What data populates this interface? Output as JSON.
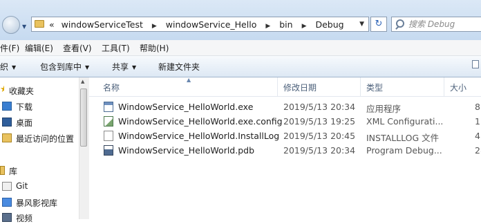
{
  "window": {
    "address": {
      "overflow": "«",
      "crumbs": [
        "windowServiceTest",
        "windowService_Hello",
        "bin",
        "Debug"
      ]
    },
    "search_placeholder": "搜索 Debug"
  },
  "menu": [
    "件(F)",
    "编辑(E)",
    "查看(V)",
    "工具(T)",
    "帮助(H)"
  ],
  "toolbar": {
    "organize": "织",
    "include_in_library": "包含到库中",
    "share": "共享",
    "new_folder": "新建文件夹"
  },
  "nav": {
    "favorites": "收藏夹",
    "items": [
      "下载",
      "桌面",
      "最近访问的位置"
    ],
    "libraries": "库",
    "lib_items": [
      "Git",
      "暴风影视库",
      "视频"
    ]
  },
  "columns": [
    "名称",
    "修改日期",
    "类型",
    "大小"
  ],
  "files": [
    {
      "name": "WindowService_HelloWorld.exe",
      "date": "2019/5/13 20:34",
      "type": "应用程序",
      "size": "8"
    },
    {
      "name": "WindowService_HelloWorld.exe.config",
      "date": "2019/5/13 19:25",
      "type": "XML Configurati...",
      "size": "1"
    },
    {
      "name": "WindowService_HelloWorld.InstallLog",
      "date": "2019/5/13 20:45",
      "type": "INSTALLLOG 文件",
      "size": "4"
    },
    {
      "name": "WindowService_HelloWorld.pdb",
      "date": "2019/5/13 20:34",
      "type": "Program Debug...",
      "size": "28"
    }
  ]
}
